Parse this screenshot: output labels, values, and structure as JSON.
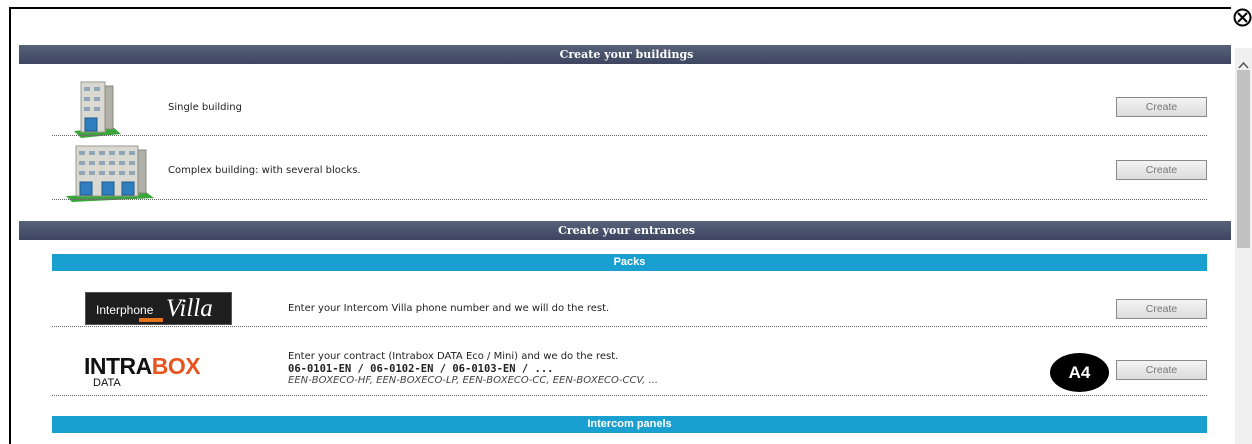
{
  "sections": {
    "buildings": "Create your buildings",
    "entrances": "Create your entrances"
  },
  "sub_sections": {
    "packs": "Packs",
    "intercom_panels": "Intercom panels"
  },
  "rows": {
    "single": {
      "label": "Single building",
      "button": "Create"
    },
    "complex": {
      "label": "Complex building: with several blocks.",
      "button": "Create"
    },
    "villa": {
      "label": "Enter your Intercom Villa phone number and we will do the rest.",
      "button": "Create",
      "logo_a": "Interphone",
      "logo_b": "Villa"
    },
    "intrabox": {
      "line1": "Enter your contract (Intrabox DATA Eco / Mini) and we do the rest.",
      "line2": "06-0101-EN / 06-0102-EN / 06-0103-EN / ...",
      "line3": "EEN-BOXECO-HF, EEN-BOXECO-LP, EEN-BOXECO-CC, EEN-BOXECO-CCV, ...",
      "button": "Create",
      "logo_a_black": "INTRA",
      "logo_a_orange": "BOX",
      "logo_b": "DATA"
    }
  },
  "badge": "A4",
  "icons": [
    "close-icon",
    "scroll-up-icon",
    "building-icon",
    "complex-building-icon"
  ],
  "colors": {
    "section_header": "#4a5370",
    "sub_header": "#1aa0d0",
    "accent_orange": "#e8541f"
  }
}
